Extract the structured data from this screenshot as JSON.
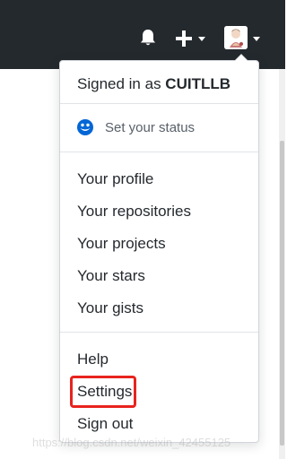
{
  "header": {
    "icons": [
      "bell-icon",
      "plus-icon",
      "avatar",
      "caret-down-icon"
    ]
  },
  "dropdown": {
    "signed_in_prefix": "Signed in as ",
    "username": "CUITLLB",
    "status": {
      "icon": "smiley-icon",
      "label": "Set your status"
    },
    "profile_section": [
      {
        "label": "Your profile"
      },
      {
        "label": "Your repositories"
      },
      {
        "label": "Your projects"
      },
      {
        "label": "Your stars"
      },
      {
        "label": "Your gists"
      }
    ],
    "account_section": [
      {
        "label": "Help"
      },
      {
        "label": "Settings"
      },
      {
        "label": "Sign out"
      }
    ]
  },
  "annotation": {
    "highlighted_item": "Settings",
    "color": "#e8231e"
  },
  "watermark": "https://blog.csdn.net/weixin_42455125",
  "colors": {
    "header_bg": "#24292e",
    "text": "#24292e",
    "muted_text": "#586069",
    "status_icon": "#0366d6"
  }
}
